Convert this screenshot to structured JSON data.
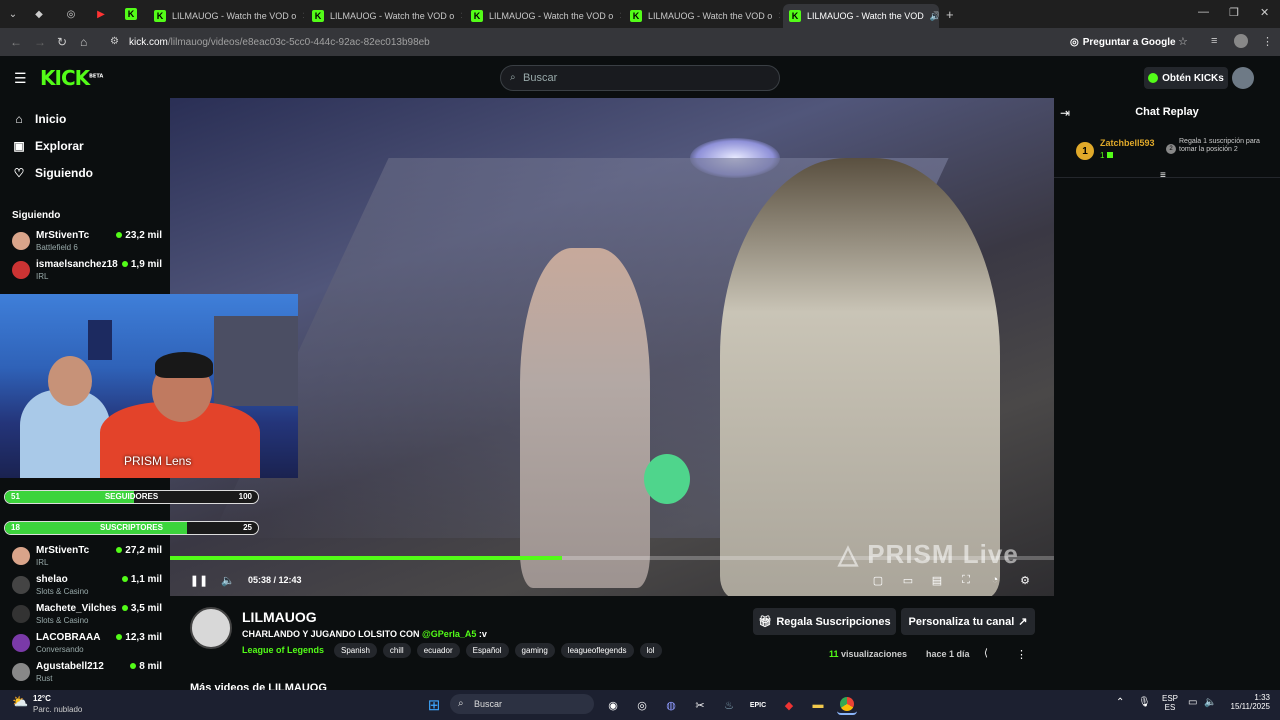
{
  "browser": {
    "tabs": [
      {
        "title": "LILMAUOG - Watch the VOD o"
      },
      {
        "title": "LILMAUOG - Watch the VOD o"
      },
      {
        "title": "LILMAUOG - Watch the VOD o"
      },
      {
        "title": "LILMAUOG - Watch the VOD o"
      },
      {
        "title": "LILMAUOG - Watch the VOD"
      }
    ],
    "url_host": "kick.com",
    "url_path": "/lilmauog/videos/e8eac03c-5cc0-444c-92ac-82ec013b98eb",
    "ask_google": "Preguntar a Google"
  },
  "header": {
    "logo": "KICK",
    "logo_badge": "BETA",
    "search_placeholder": "Buscar",
    "get_kicks": "Obtén KICKs"
  },
  "sidebar": {
    "nav": [
      {
        "label": "Inicio",
        "icon": "home-icon"
      },
      {
        "label": "Explorar",
        "icon": "compass-icon"
      },
      {
        "label": "Siguiendo",
        "icon": "heart-icon"
      }
    ],
    "following_title": "Siguiendo",
    "following": [
      {
        "name": "MrStivenTc",
        "category": "Battlefield 6",
        "viewers": "23,2 mil"
      },
      {
        "name": "ismaelsanchez18",
        "category": "IRL",
        "viewers": "1,9 mil"
      }
    ],
    "recommended": [
      {
        "name": "MrStivenTc",
        "category": "IRL",
        "viewers": "27,2 mil"
      },
      {
        "name": "shelao",
        "category": "Slots & Casino",
        "viewers": "1,1 mil"
      },
      {
        "name": "Machete_Vilches",
        "category": "Slots & Casino",
        "viewers": "3,5 mil"
      },
      {
        "name": "LACOBRAAA",
        "category": "Conversando",
        "viewers": "12,3 mil"
      },
      {
        "name": "Agustabell212",
        "category": "Rust",
        "viewers": "8 mil"
      }
    ]
  },
  "overlay": {
    "cam_label": "PRISM Lens",
    "followers_bar": {
      "label": "SEGUIDORES",
      "current": "51",
      "goal": "100",
      "fraction": 0.51
    },
    "subs_bar": {
      "label": "SUSCRIPTORES",
      "current": "18",
      "goal": "25",
      "fraction": 0.72
    },
    "watermark": "PRISM Live"
  },
  "player": {
    "time": "05:38 / 12:43",
    "progress": 0.443
  },
  "stream": {
    "channel": "LILMAUOG",
    "title": "CHARLANDO Y JUGANDO LOLSITO CON",
    "mention": "@GPerla_A5",
    "title_suffix": ":v",
    "category": "League of Legends",
    "tags": [
      "Spanish",
      "chill",
      "ecuador",
      "Español",
      "gaming",
      "leagueoflegends",
      "lol"
    ],
    "gift_button": "Regala Suscripciones",
    "customize_button": "Personaliza tu canal",
    "views_count": "11",
    "views_label": "visualizaciones",
    "age": "hace 1 día",
    "more_videos": "Más videos de LILMAUOG"
  },
  "chat": {
    "title": "Chat Replay",
    "entry": {
      "rank": "1",
      "user": "Zatchbell593",
      "badge_count": "1",
      "message": "Regala 1 suscripción para tomar la posición 2"
    }
  },
  "taskbar": {
    "weather_temp": "12°C",
    "weather_desc": "Parc. nublado",
    "search": "Buscar",
    "lang1": "ESP",
    "lang2": "ES",
    "time": "1:33",
    "date": "15/11/2025"
  },
  "colors": {
    "brand": "#53fc18",
    "bg": "#0b0e0f"
  }
}
